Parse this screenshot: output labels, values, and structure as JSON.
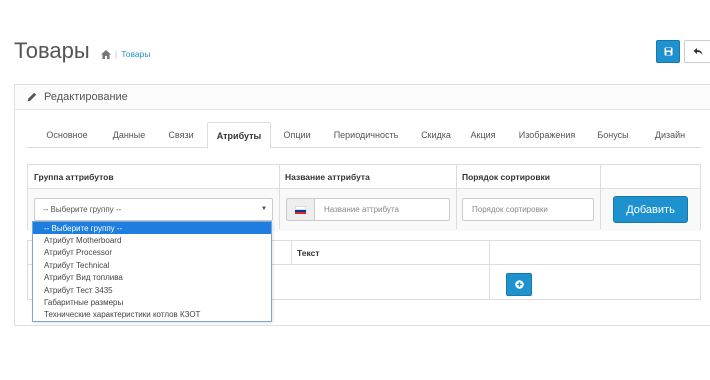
{
  "header": {
    "title": "Товары",
    "breadcrumb": "Товары"
  },
  "panel": {
    "title": "Редактирование"
  },
  "tabs": [
    {
      "label": "Основное"
    },
    {
      "label": "Данные"
    },
    {
      "label": "Связи"
    },
    {
      "label": "Атрибуты",
      "active": true
    },
    {
      "label": "Опции"
    },
    {
      "label": "Периодичность"
    },
    {
      "label": "Скидка"
    },
    {
      "label": "Акция"
    },
    {
      "label": "Изображения"
    },
    {
      "label": "Бонусы"
    },
    {
      "label": "Дизайн"
    }
  ],
  "attr_table": {
    "col_group": "Группа аттрибутов",
    "col_name": "Название аттрибута",
    "col_sort": "Порядок сортировки",
    "select_value": "-- Выберите группу --",
    "name_placeholder": "Название аттрибута",
    "sort_placeholder": "Порядок сортировки",
    "add_label": "Добавить"
  },
  "second_table": {
    "col_text": "Текст"
  },
  "dropdown": {
    "options": [
      "-- Выберите группу --",
      "Атрибут Motherboard",
      "Атрибут Processor",
      "Атрибут Technical",
      "Атрибут Вид топлива",
      "Атрибут Тест 3435",
      "Габаритные размеры",
      "Технические характеристики котлов КЗОТ"
    ],
    "selected_index": 0
  },
  "colors": {
    "primary": "#1e91cf",
    "dropdown_highlight": "#1e7ee0",
    "flag": [
      "#ffffff",
      "#0039a6",
      "#d52b1e"
    ]
  }
}
